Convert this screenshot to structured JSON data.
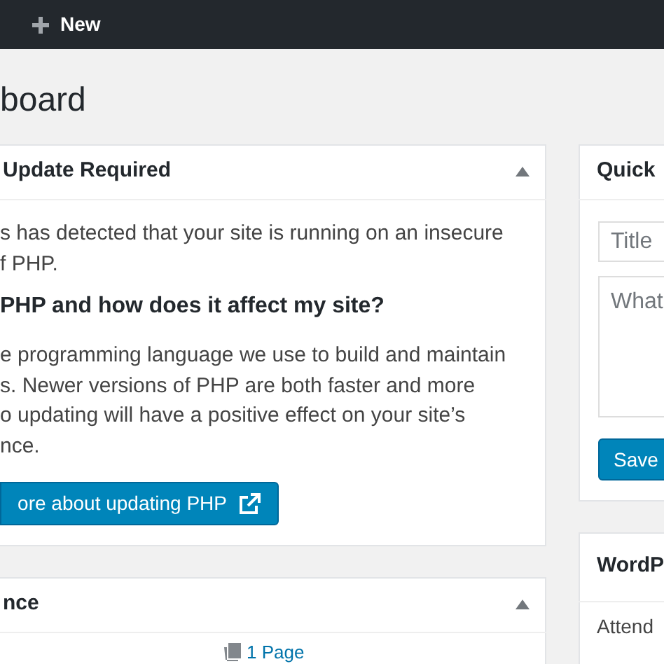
{
  "toolbar": {
    "new_label": "New"
  },
  "page_title": "board",
  "php_panel": {
    "title": "Update Required",
    "expanded": true,
    "lines": [
      {
        "kind": "text",
        "text": "s has detected that your site is running on an insecure"
      },
      {
        "kind": "text",
        "text": "f PHP."
      },
      {
        "kind": "heading",
        "text": "PHP and how does it affect my site?"
      },
      {
        "kind": "text",
        "text": "e programming language we use to build and maintain"
      },
      {
        "kind": "text",
        "text": "s. Newer versions of PHP are both faster and more"
      },
      {
        "kind": "text",
        "text": "o updating will have a positive effect on your site’s"
      },
      {
        "kind": "text",
        "text": "nce."
      }
    ],
    "button": "ore about updating PHP"
  },
  "glance_panel": {
    "title": "nce",
    "expanded": true,
    "item": "1 Page"
  },
  "quick_draft": {
    "title": "Quick",
    "title_placeholder": "Title",
    "content_placeholder": "What",
    "save": "Save"
  },
  "events_panel": {
    "title": "WordP",
    "text": "Attend"
  }
}
